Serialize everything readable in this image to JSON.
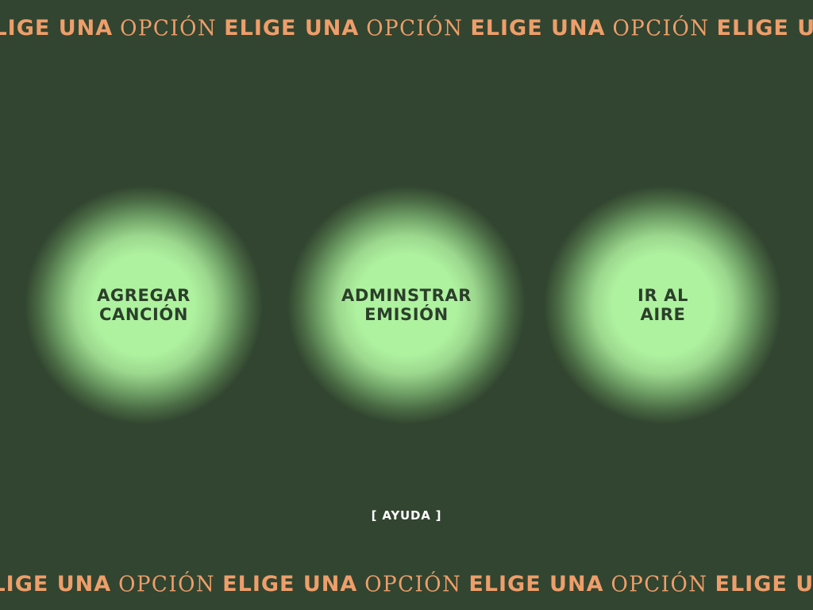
{
  "marquee": {
    "bold_text": "ELIGE UNA",
    "thin_text": "OPCIÓN"
  },
  "options": [
    {
      "line1": "AGREGAR",
      "line2": "CANCIÓN"
    },
    {
      "line1": "ADMINSTRAR",
      "line2": "EMISIÓN"
    },
    {
      "line1": "IR AL",
      "line2": "AIRE"
    }
  ],
  "help_label": "[ AYUDA ]",
  "colors": {
    "background": "#324530",
    "accent": "#EE9E6A",
    "orb_core": "#aef29f",
    "orb_text": "#2c3f2b"
  }
}
